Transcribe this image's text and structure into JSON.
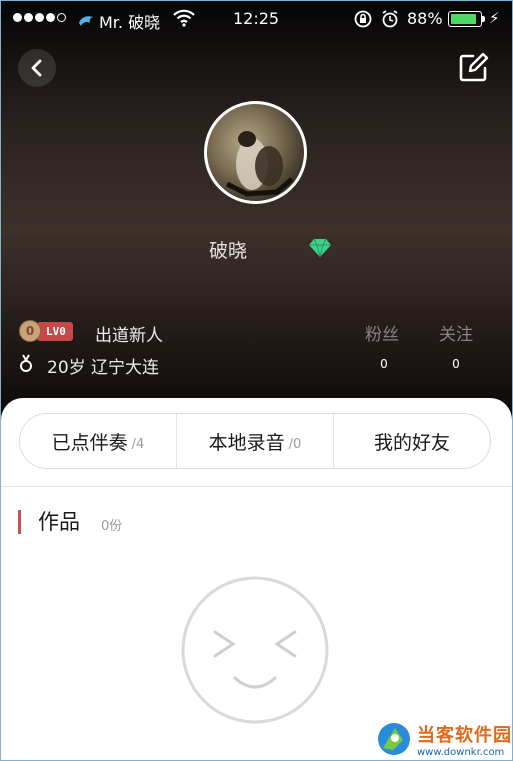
{
  "status_bar": {
    "carrier": "Mr. 破晓",
    "time": "12:25",
    "battery_percent": "88%",
    "battery_level": 0.88,
    "signal_bars_filled": 4,
    "signal_bars_total": 5
  },
  "nav": {
    "back_icon": "chevron-left-icon",
    "edit_icon": "edit-icon"
  },
  "profile": {
    "username": "破晓",
    "vip_icon": "diamond-icon",
    "level_number": "0",
    "level_tag": "LV0",
    "level_title": "出道新人",
    "age_location": "20岁 辽宁大连",
    "gender_icon": "male-icon"
  },
  "stats": {
    "fans_label": "粉丝",
    "fans_value": "0",
    "follow_label": "关注",
    "follow_value": "0"
  },
  "tabs": [
    {
      "label": "已点伴奏",
      "count": "/4"
    },
    {
      "label": "本地录音",
      "count": "/0"
    },
    {
      "label": "我的好友",
      "count": ""
    }
  ],
  "works": {
    "title": "作品",
    "count": "0份",
    "empty_icon": "smiley-face-icon"
  },
  "watermark": {
    "title": "当客软件园",
    "url": "www.downkr.com"
  },
  "colors": {
    "accent_red": "#c95353",
    "battery_green": "#4cd964",
    "diamond_green": "#3fd08a"
  }
}
